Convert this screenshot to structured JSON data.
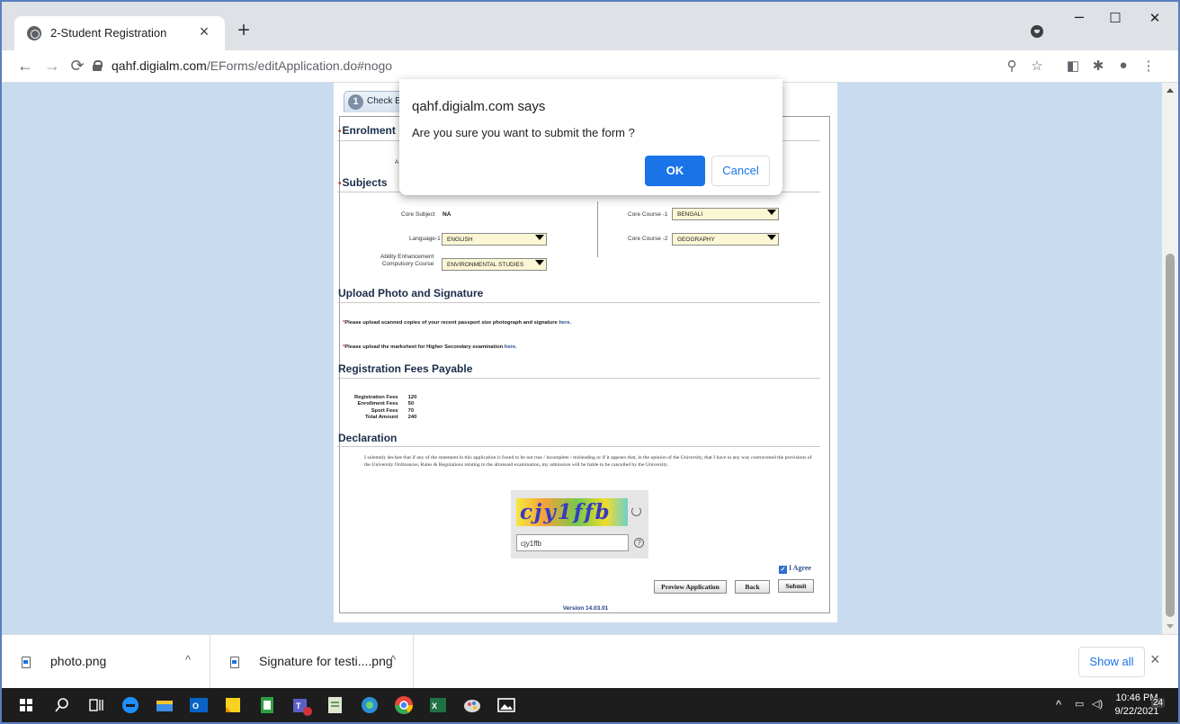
{
  "browser": {
    "tab_title": "2-Student Registration",
    "tab_close": "×",
    "new_tab": "+",
    "url_domain": "qahf.digialm.com",
    "url_path": "/EForms/editApplication.do#nogo",
    "window_min": "–",
    "window_max": "☐",
    "window_close": "✕"
  },
  "form": {
    "step_number": "1",
    "step_label": "Check E",
    "enrolment_title": "Enrolment I",
    "enrolment_stub": "A",
    "subjects_title": "Subjects",
    "core_subject_label": "Core Subject",
    "core_subject_value": "NA",
    "language_label": "Language-1",
    "language_value": "ENGLISH",
    "aec_label_line1": "Ability Enhancement",
    "aec_label_line2": "Compulsory Course",
    "aec_value": "ENVIRONMENTAL STUDIES",
    "core_course1_label": "Core Course -1",
    "core_course1_value": "BENGALI",
    "core_course2_label": "Core Course -2",
    "core_course2_value": "GEOGRAPHY",
    "upload_title": "Upload Photo and Signature",
    "upload_note1": "Please upload scanned copies of your recent passport size photograph and signature",
    "upload_note2": "Please upload the marksheet for Higher Secondary examination",
    "here_link": "here.",
    "fees_title": "Registration Fees Payable",
    "fees": [
      {
        "label": "Registration Fees",
        "value": "120"
      },
      {
        "label": "Enrollment Fees",
        "value": "50"
      },
      {
        "label": "Sport Fees",
        "value": "70"
      },
      {
        "label": "Total Amount",
        "value": "240"
      }
    ],
    "declaration_title": "Declaration",
    "declaration_text": "I solemnly declare that if any of the statement in this application is found to be not true / incomplete / misleading or if it appears that, in the opinion of the University, that I have in any way contravened the provisions of the University Ordinances, Rules & Regulations relating to the aforesaid examination, my admission will be liable to be cancelled by the University.",
    "captcha_text": "cjy1ffb",
    "captcha_input": "cjy1ffb",
    "help_glyph": "?",
    "agree_label": "I Agree",
    "preview_button": "Preview Application",
    "back_button": "Back",
    "submit_button": "Submit",
    "version": "Version 14.03.01"
  },
  "dialog": {
    "title": "qahf.digialm.com says",
    "message": "Are you sure you want to submit the form ?",
    "ok": "OK",
    "cancel": "Cancel"
  },
  "downloads": {
    "items": [
      {
        "name": "photo.png"
      },
      {
        "name": "Signature for testi....png"
      }
    ],
    "show_all": "Show all",
    "close": "×"
  },
  "taskbar": {
    "time": "10:46 PM",
    "date": "9/22/2021",
    "notification_count": "24"
  },
  "colors": {
    "accent": "#1a73e8",
    "viewport_bg": "#c9dcef",
    "taskbar_bg": "#1d1d1d"
  }
}
